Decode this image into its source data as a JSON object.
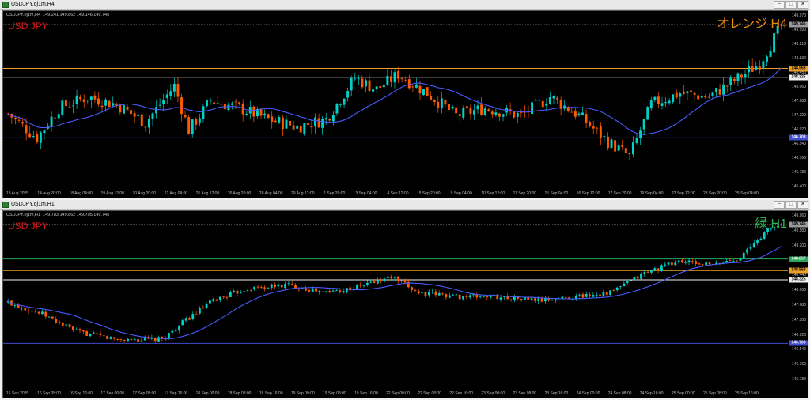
{
  "colors": {
    "bull": "#00d2c8",
    "bear": "#ff5a00",
    "ma": "#4a5cff",
    "orange_line": "#f0a020",
    "white_line": "#f0f0f0",
    "blue_line": "#3f4ccf",
    "green_line": "#27a85a",
    "symbol_label": "#e21b1b",
    "label_h4": "#e88a12",
    "label_h1": "#2fb34f"
  },
  "window_h4": {
    "title": "USDJPY.oj1m,H4",
    "info_line": "USDJPY.oj1m,H4  149.241 149.862 149.146 149.745",
    "symbol_label": "USD JPY",
    "timeframe_label": "オレンジ H4",
    "buttons": [
      "−",
      "□",
      "✕"
    ],
    "price_axis": [
      "149.970",
      "149.590",
      "149.210",
      "148.830",
      "148.450",
      "148.060",
      "147.680",
      "147.300",
      "146.920",
      "146.540",
      "146.160",
      "145.780",
      "145.400"
    ],
    "price_tags": [
      {
        "text": "149.745",
        "kind": "current"
      },
      {
        "text": "148.563",
        "kind": "orange"
      },
      {
        "text": "148.325",
        "kind": "white"
      },
      {
        "text": "146.703",
        "kind": "blue"
      }
    ],
    "time_axis": [
      "13 Aug 2025",
      "14 Aug 20:00",
      "18 Aug 04:00",
      "19 Aug 12:00",
      "20 Aug 20:00",
      "22 Aug 04:00",
      "25 Aug 12:00",
      "26 Aug 20:00",
      "28 Aug 04:00",
      "29 Aug 12:00",
      "1 Sep 20:00",
      "3 Sep 04:00",
      "4 Sep 12:00",
      "5 Sep 20:00",
      "9 Sep 04:00",
      "10 Sep 12:00",
      "11 Sep 20:00",
      "15 Sep 04:00",
      "16 Sep 12:00",
      "17 Sep 20:00",
      "19 Sep 04:00",
      "22 Sep 12:00",
      "23 Sep 20:00",
      "25 Sep 04:00"
    ]
  },
  "window_h1": {
    "title": "USDJPY.oj1m,H1",
    "info_line": "USDJPY.oj1m,H1  149.783 149.862 149.705 149.745",
    "symbol_label": "USD JPY",
    "timeframe_label": "緑 H1",
    "buttons": [
      "−",
      "□",
      "✕"
    ],
    "price_axis": [
      "149.960",
      "149.580",
      "149.200",
      "148.820",
      "148.440",
      "148.060",
      "147.680",
      "147.300",
      "146.920",
      "146.540",
      "146.160",
      "145.780"
    ],
    "price_tags": [
      {
        "text": "149.745",
        "kind": "current"
      },
      {
        "text": "148.857",
        "kind": "green"
      },
      {
        "text": "148.563",
        "kind": "orange"
      },
      {
        "text": "148.325",
        "kind": "white"
      },
      {
        "text": "146.703",
        "kind": "blue"
      }
    ],
    "time_axis": [
      "16 Sep 2025",
      "16 Sep 08:00",
      "16 Sep 16:00",
      "17 Sep 00:00",
      "17 Sep 08:00",
      "17 Sep 16:00",
      "18 Sep 00:00",
      "18 Sep 08:00",
      "18 Sep 16:00",
      "19 Sep 00:00",
      "19 Sep 08:00",
      "19 Sep 16:00",
      "22 Sep 00:00",
      "22 Sep 08:00",
      "22 Sep 16:00",
      "23 Sep 00:00",
      "23 Sep 08:00",
      "23 Sep 16:00",
      "24 Sep 00:00",
      "24 Sep 08:00",
      "24 Sep 16:00",
      "25 Sep 00:00",
      "25 Sep 08:00",
      "25 Sep 16:00"
    ]
  }
}
